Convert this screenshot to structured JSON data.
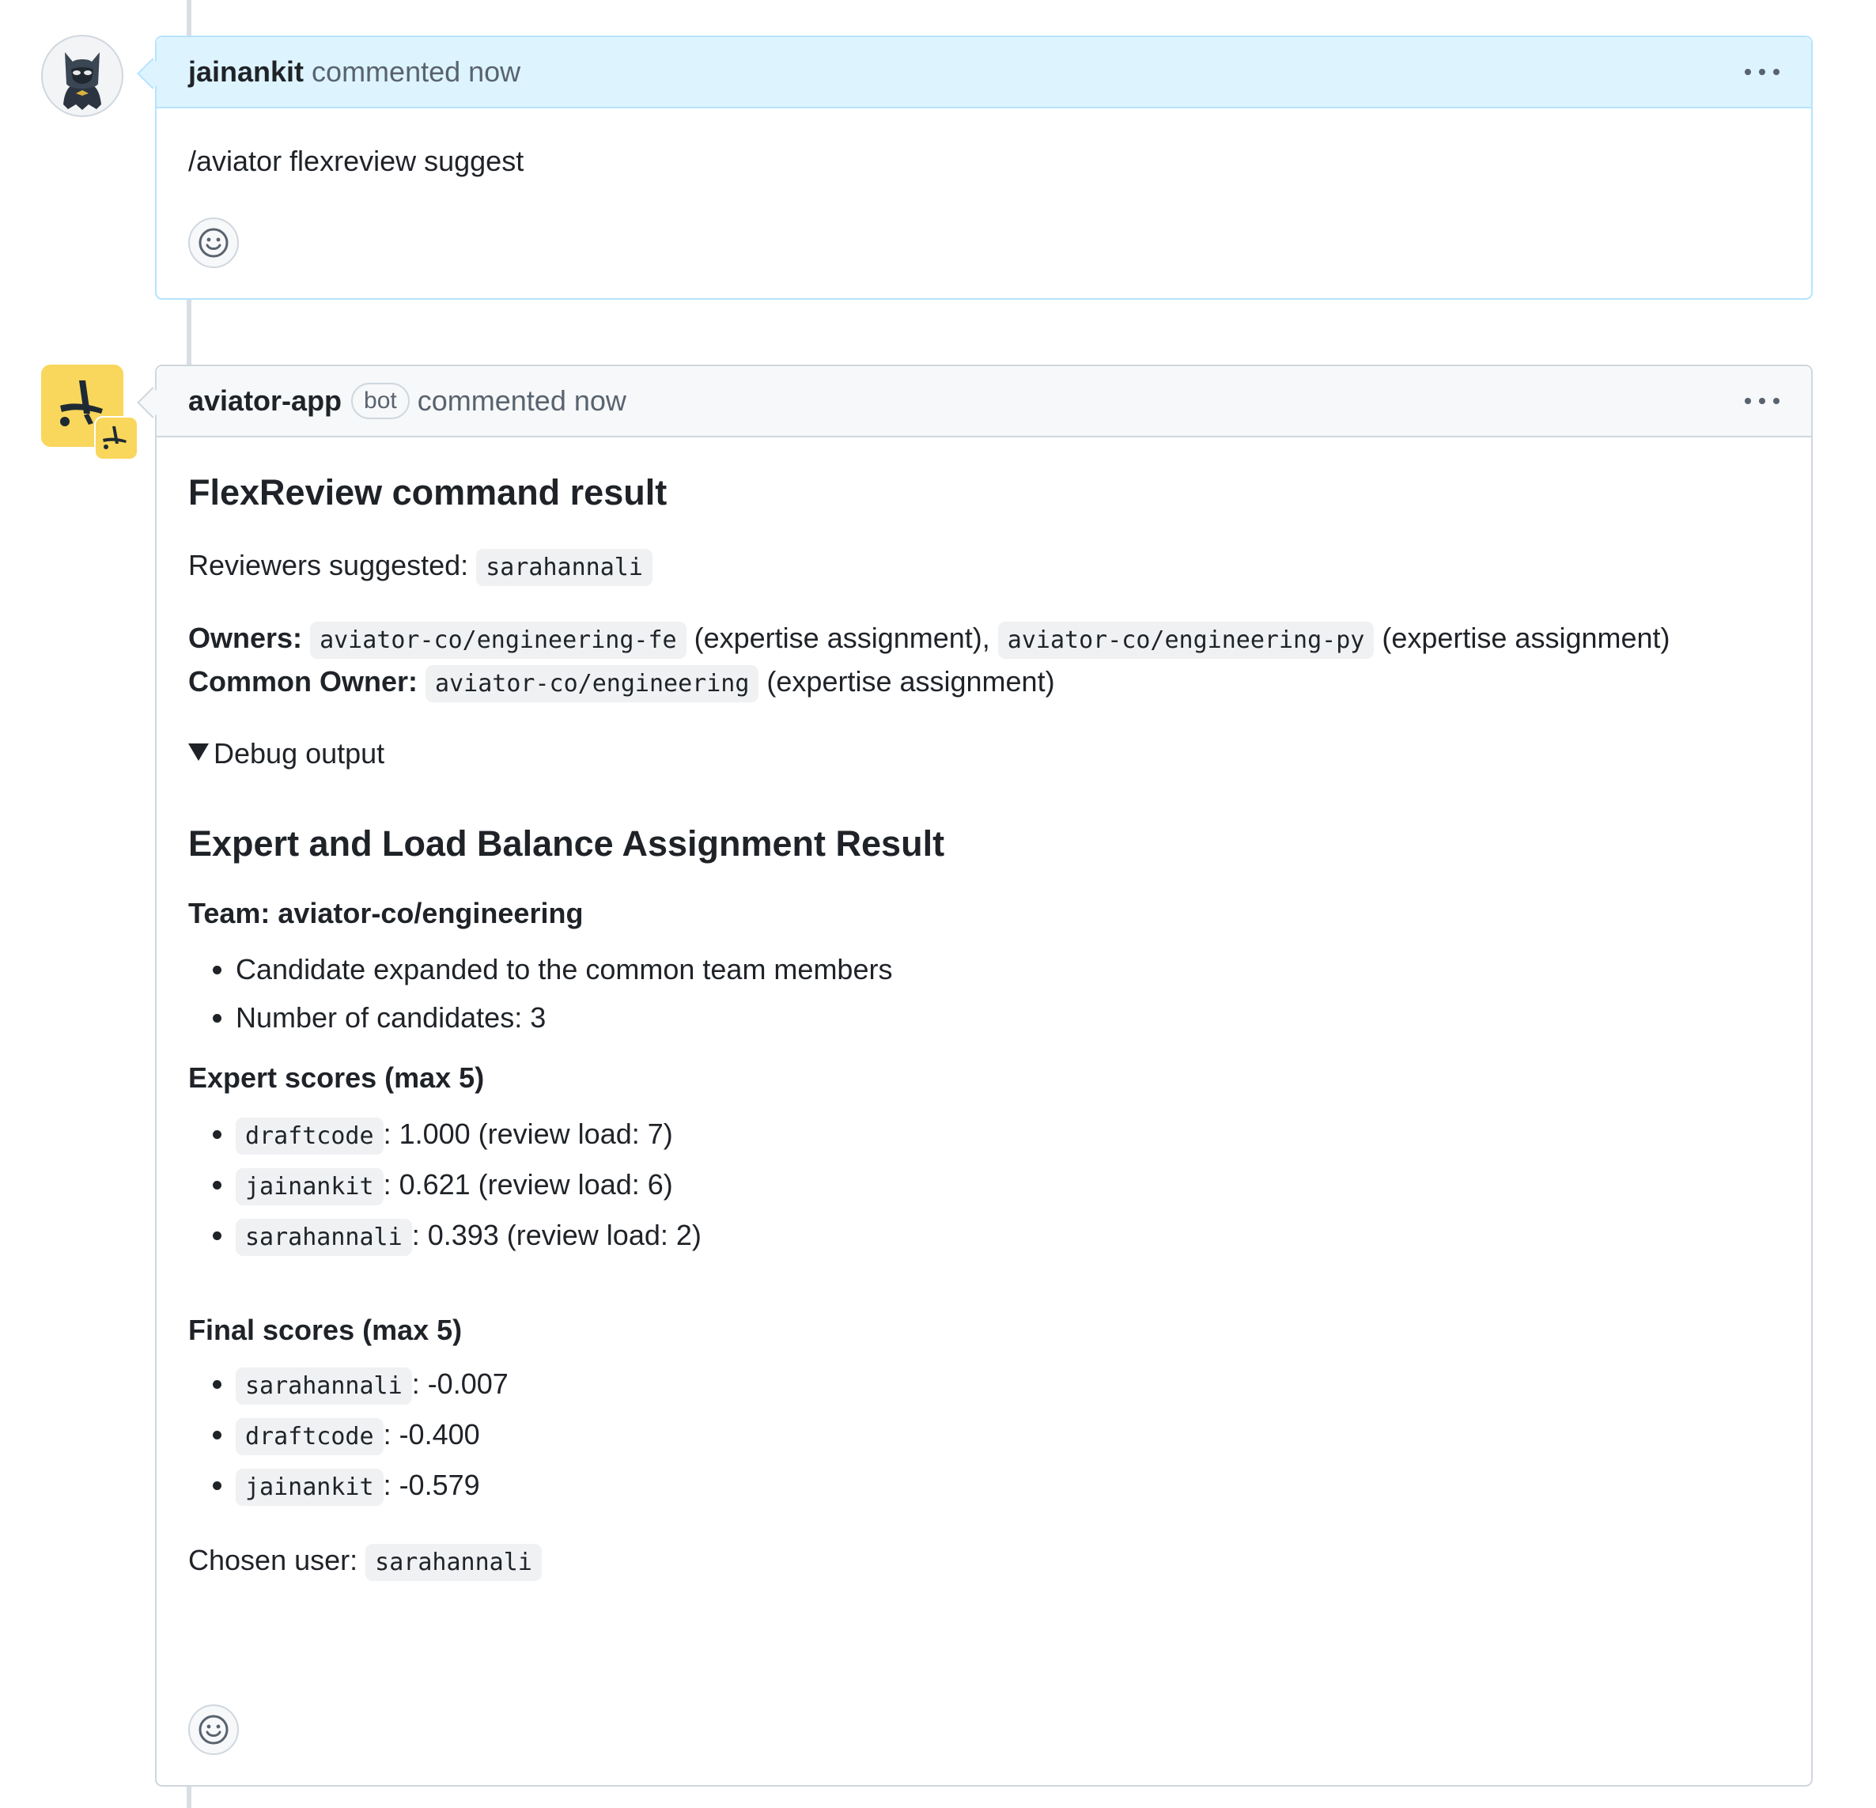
{
  "comment1": {
    "author": "jainankit",
    "meta": "commented now",
    "body": "/aviator flexreview suggest"
  },
  "comment2": {
    "author": "aviator-app",
    "badge": "bot",
    "meta": "commented now",
    "heading": "FlexReview command result",
    "reviewers_label": "Reviewers suggested:",
    "reviewers_value": "sarahannali",
    "owners_label": "Owners:",
    "owners": [
      {
        "code": "aviator-co/engineering-fe",
        "note": "(expertise assignment),"
      },
      {
        "code": "aviator-co/engineering-py",
        "note": "(expertise assignment)"
      }
    ],
    "common_owner_label": "Common Owner:",
    "common_owner_code": "aviator-co/engineering",
    "common_owner_note": "(expertise assignment)",
    "debug_summary": "Debug output",
    "result_heading": "Expert and Load Balance Assignment Result",
    "team_heading": "Team: aviator-co/engineering",
    "team_items": [
      "Candidate expanded to the common team members",
      "Number of candidates: 3"
    ],
    "expert_heading": "Expert scores (max 5)",
    "expert_scores": [
      {
        "user": "draftcode",
        "rest": ": 1.000 (review load: 7)"
      },
      {
        "user": "jainankit",
        "rest": ": 0.621 (review load: 6)"
      },
      {
        "user": "sarahannali",
        "rest": ": 0.393 (review load: 2)"
      }
    ],
    "final_heading": "Final scores (max 5)",
    "final_scores": [
      {
        "user": "sarahannali",
        "rest": ": -0.007"
      },
      {
        "user": "draftcode",
        "rest": ": -0.400"
      },
      {
        "user": "jainankit",
        "rest": ": -0.579"
      }
    ],
    "chosen_label": "Chosen user:",
    "chosen_value": "sarahannali"
  },
  "colors": {
    "self_header_bg": "#ddf4ff",
    "self_border": "#b6e3ff",
    "header_bg": "#f6f8fa",
    "border": "#d0d7de",
    "code_bg": "#eff1f3",
    "aviator_yellow": "#f9d65c"
  },
  "icons": [
    "batman-avatar-icon",
    "aviator-logo-icon",
    "smiley-icon",
    "kebab-menu-icon",
    "disclosure-triangle-icon"
  ]
}
